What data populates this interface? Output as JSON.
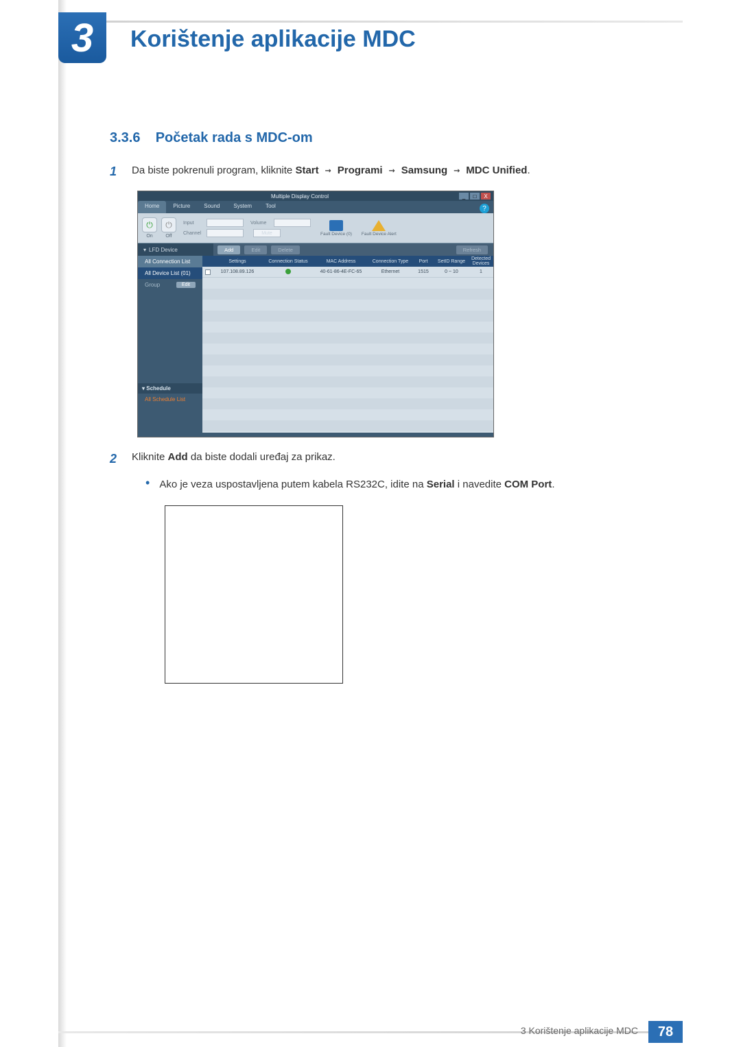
{
  "chapter": {
    "number": "3",
    "title": "Korištenje aplikacije MDC"
  },
  "section": {
    "number": "3.3.6",
    "title": "Početak rada s MDC-om"
  },
  "step1": {
    "num": "1",
    "pre": "Da biste pokrenuli program, kliknite ",
    "b1": "Start",
    "arr": " → ",
    "b2": "Programi",
    "b3": "Samsung",
    "b4": "MDC Unified",
    "post": "."
  },
  "step2": {
    "num": "2",
    "pre": "Kliknite ",
    "b1": "Add",
    "post": " da biste dodali uređaj za prikaz."
  },
  "bullet1": {
    "pre": "Ako je veza uspostavljena putem kabela RS232C, idite na ",
    "b1": "Serial",
    "mid": " i navedite ",
    "b2": "COM Port",
    "post": "."
  },
  "mdc": {
    "window_title": "Multiple Display Control",
    "help": "?",
    "win": {
      "min": "_",
      "max": "□",
      "close": "X"
    },
    "tabs": [
      "Home",
      "Picture",
      "Sound",
      "System",
      "Tool"
    ],
    "toolbar": {
      "on": "On",
      "off": "Off",
      "input": "Input",
      "channel": "Channel",
      "volume": "Volume",
      "mute": "Mute",
      "fault0": "Fault Device (0)",
      "faultA": "Fault Device Alert"
    },
    "midbar": {
      "add": "Add",
      "edit": "Edit",
      "delete": "Delete",
      "refresh": "Refresh"
    },
    "side": {
      "lfd": "LFD Device",
      "all_conn": "All Connection List",
      "all_dev": "All Device List (01)",
      "group": "Group",
      "edit": "Edit",
      "sched": "Schedule",
      "all_sched": "All Schedule List"
    },
    "table": {
      "head": [
        "",
        "Settings",
        "Connection Status",
        "MAC Address",
        "Connection Type",
        "Port",
        "SetID Range",
        "Detected Devices"
      ],
      "row": [
        "",
        "107.108.89.126",
        "●",
        "40-61-86-4E-FC-65",
        "Ethernet",
        "1515",
        "0 ~ 10",
        "1"
      ]
    }
  },
  "footer": {
    "label": "3 Korištenje aplikacije MDC",
    "page": "78"
  }
}
